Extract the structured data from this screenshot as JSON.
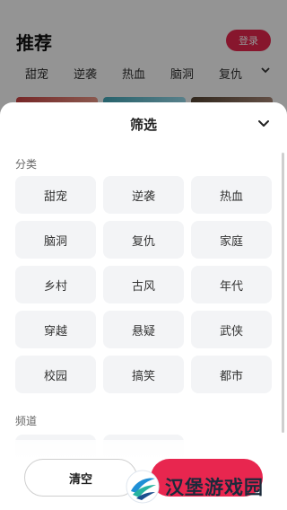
{
  "background": {
    "title": "推荐",
    "login_label": "登录",
    "tabs": [
      "甜宠",
      "逆袭",
      "热血",
      "脑洞",
      "复仇"
    ]
  },
  "sheet": {
    "title": "筛选",
    "sections": [
      {
        "label": "分类",
        "items": [
          "甜宠",
          "逆袭",
          "热血",
          "脑洞",
          "复仇",
          "家庭",
          "乡村",
          "古风",
          "年代",
          "穿越",
          "悬疑",
          "武侠",
          "校园",
          "搞笑",
          "都市"
        ]
      },
      {
        "label": "频道",
        "items": [
          "",
          ""
        ]
      }
    ]
  },
  "footer": {
    "clear_label": "清空",
    "confirm_label": ""
  },
  "watermark": {
    "text": "汉堡游戏园"
  },
  "colors": {
    "accent": "#e8264f",
    "chip_bg": "#f3f4f6"
  }
}
